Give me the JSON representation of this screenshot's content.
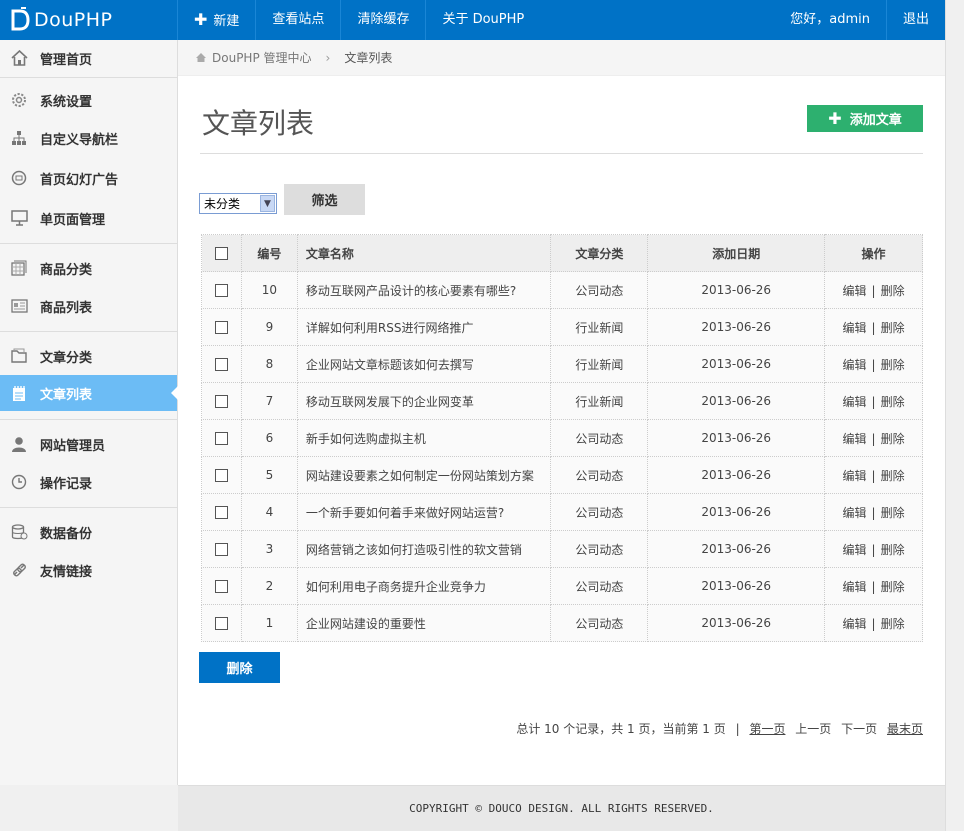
{
  "app": {
    "logo": "DouPHP"
  },
  "topnav": {
    "new_label": "新建",
    "view_site": "查看站点",
    "clear_cache": "清除缓存",
    "about": "关于 DouPHP",
    "greeting": "您好，admin",
    "logout": "退出"
  },
  "sidebar": {
    "items": [
      {
        "label": "管理首页",
        "icon": "home-icon"
      },
      {
        "label": "系统设置",
        "icon": "gear-icon"
      },
      {
        "label": "自定义导航栏",
        "icon": "sitemap-icon"
      },
      {
        "label": "首页幻灯广告",
        "icon": "slideshow-icon"
      },
      {
        "label": "单页面管理",
        "icon": "presentation-icon"
      },
      {
        "label": "商品分类",
        "icon": "grid-icon"
      },
      {
        "label": "商品列表",
        "icon": "list-card-icon"
      },
      {
        "label": "文章分类",
        "icon": "folder-icon"
      },
      {
        "label": "文章列表",
        "icon": "notepad-icon",
        "active": true
      },
      {
        "label": "网站管理员",
        "icon": "user-icon"
      },
      {
        "label": "操作记录",
        "icon": "clock-icon"
      },
      {
        "label": "数据备份",
        "icon": "database-icon"
      },
      {
        "label": "友情链接",
        "icon": "link-icon"
      }
    ]
  },
  "breadcrumb": {
    "home": "DouPHP 管理中心",
    "current": "文章列表"
  },
  "main": {
    "title": "文章列表",
    "add_button": "添加文章",
    "filter_selected": "未分类",
    "filter_button": "筛选",
    "delete_button": "删除"
  },
  "table": {
    "headers": {
      "id": "编号",
      "name": "文章名称",
      "category": "文章分类",
      "date": "添加日期",
      "ops": "操作"
    },
    "edit_label": "编辑",
    "op_sep": "|",
    "delete_label": "删除",
    "rows": [
      {
        "id": "10",
        "name": "移动互联网产品设计的核心要素有哪些?",
        "category": "公司动态",
        "date": "2013-06-26"
      },
      {
        "id": "9",
        "name": "详解如何利用RSS进行网络推广",
        "category": "行业新闻",
        "date": "2013-06-26"
      },
      {
        "id": "8",
        "name": "企业网站文章标题该如何去撰写",
        "category": "行业新闻",
        "date": "2013-06-26"
      },
      {
        "id": "7",
        "name": "移动互联网发展下的企业网变革",
        "category": "行业新闻",
        "date": "2013-06-26"
      },
      {
        "id": "6",
        "name": "新手如何选购虚拟主机",
        "category": "公司动态",
        "date": "2013-06-26"
      },
      {
        "id": "5",
        "name": "网站建设要素之如何制定一份网站策划方案",
        "category": "公司动态",
        "date": "2013-06-26"
      },
      {
        "id": "4",
        "name": "一个新手要如何着手来做好网站运营?",
        "category": "公司动态",
        "date": "2013-06-26"
      },
      {
        "id": "3",
        "name": "网络营销之该如何打造吸引性的软文营销",
        "category": "公司动态",
        "date": "2013-06-26"
      },
      {
        "id": "2",
        "name": "如何利用电子商务提升企业竞争力",
        "category": "公司动态",
        "date": "2013-06-26"
      },
      {
        "id": "1",
        "name": "企业网站建设的重要性",
        "category": "公司动态",
        "date": "2013-06-26"
      }
    ]
  },
  "pager": {
    "summary": "总计 10 个记录，共 1 页，当前第 1 页",
    "sep": "|",
    "first": "第一页",
    "prev": "上一页",
    "next": "下一页",
    "last": "最末页"
  },
  "footer": {
    "copyright": "COPYRIGHT © DOUCO DESIGN. ALL RIGHTS RESERVED."
  }
}
